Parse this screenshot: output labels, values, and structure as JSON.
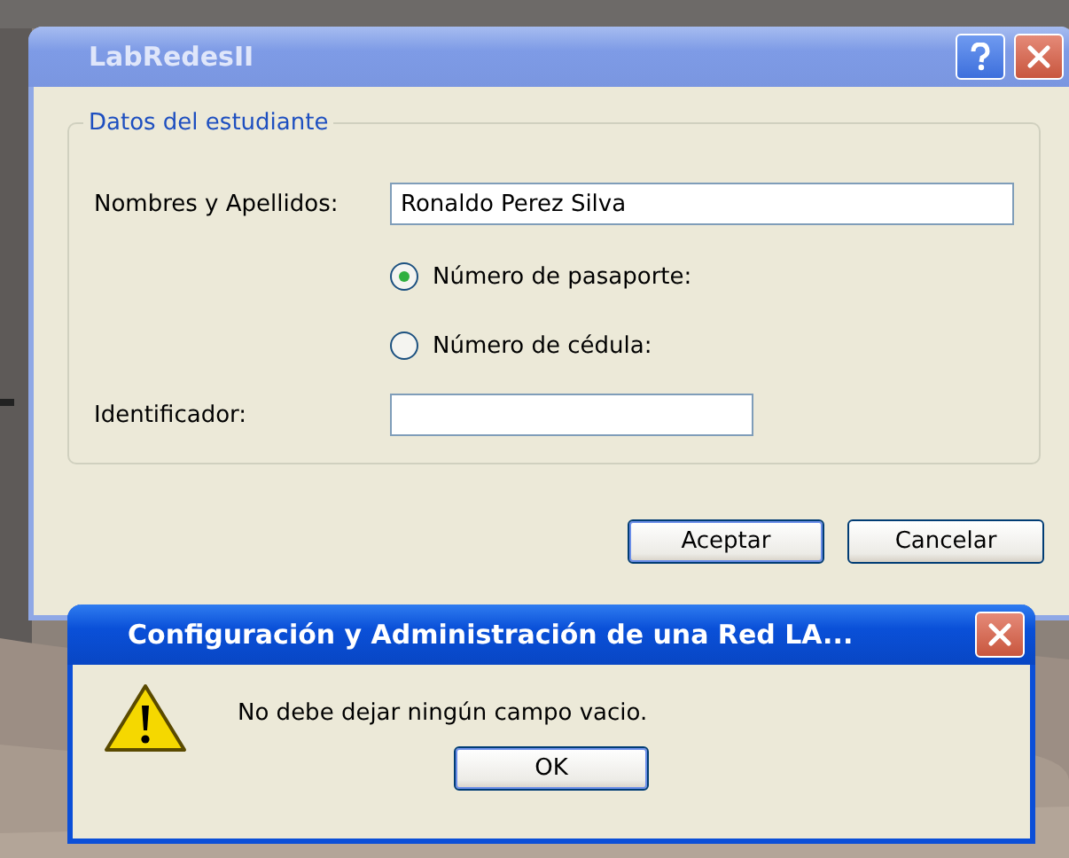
{
  "window": {
    "title": "LabRedesII",
    "active": false
  },
  "group": {
    "legend": "Datos del estudiante"
  },
  "name_field": {
    "label": "Nombres y Apellidos:",
    "value": "Ronaldo Perez Silva"
  },
  "id_options": [
    {
      "label": "Número de pasaporte:",
      "selected": true
    },
    {
      "label": "Número de cédula:",
      "selected": false
    }
  ],
  "id_field": {
    "label": "Identificador:"
  },
  "buttons": [
    {
      "label": "Aceptar",
      "default": true
    },
    {
      "label": "Cancelar",
      "default": false
    }
  ],
  "message_box": {
    "title": "Configuración y Administración de una Red LA...",
    "active": true,
    "message": "No debe dejar ningún campo vacio.",
    "button": "OK"
  }
}
